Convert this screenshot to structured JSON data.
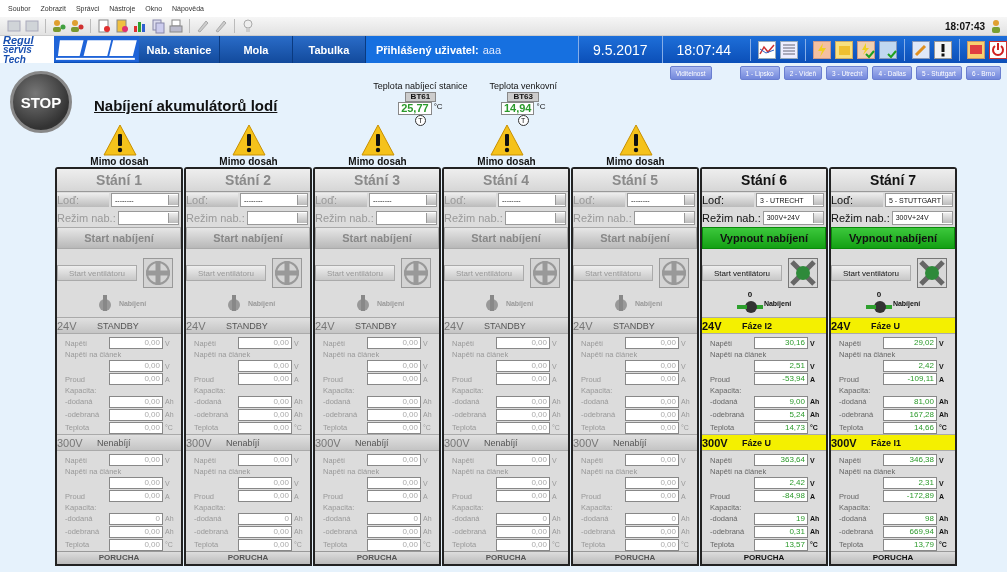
{
  "menu": [
    "Soubor",
    "Zobrazit",
    "Správci",
    "Nástroje",
    "Okno",
    "Nápověda"
  ],
  "toolbar": {
    "clock": "18:07:43"
  },
  "logo": {
    "line1": "Regul",
    "line2": "servis Tech"
  },
  "nav": {
    "tabs": [
      {
        "label": "Nab. stanice",
        "selected": false
      },
      {
        "label": "Mola",
        "selected": false
      },
      {
        "label": "Tabulka",
        "selected": false
      }
    ],
    "user_label": "Přihlášený uživatel:",
    "user_name": "aaa",
    "date": "9.5.2017",
    "time": "18:07:44"
  },
  "page": {
    "stop": "STOP",
    "title": "Nabíjení akumulátorů lodí",
    "sensors": [
      {
        "label": "Teplota nabíjecí stanice",
        "tag": "BT61",
        "value": "25,77",
        "unit": "°C",
        "mark": "T"
      },
      {
        "label": "Teplota venkovní",
        "tag": "BT63",
        "value": "14,94",
        "unit": "°C",
        "mark": "T"
      }
    ],
    "view_buttons": [
      "Viditelnost",
      "1 - Lipsko",
      "2 - Vídeň",
      "3 - Utrecht",
      "4 - Dallas",
      "5 - Stuttgart",
      "6 - Brno"
    ]
  },
  "stations": [
    {
      "title": "Stání 1",
      "warning": "Mimo dosah",
      "charging": false,
      "ship_label": "Loď:",
      "ship": "--------",
      "mode_label": "Režim nab.:",
      "charge_button": "Start nabíjení",
      "fan_button": "Start ventilátoru",
      "knob_label": "Nabíjení",
      "fault": "PORUCHA",
      "sections": [
        {
          "voltage": "24V",
          "status": "STANDBY",
          "highlighted": false,
          "rows": [
            {
              "kind": "inline",
              "label": "Napětí",
              "value": "0,00",
              "unit": "V"
            },
            {
              "kind": "caption",
              "label": "Napětí na článek"
            },
            {
              "kind": "field",
              "value": "0,00",
              "unit": "V"
            },
            {
              "kind": "inline",
              "label": "Proud",
              "value": "0,00",
              "unit": "A"
            },
            {
              "kind": "caption",
              "label": "Kapacita:"
            },
            {
              "kind": "inline",
              "label": "-dodaná",
              "value": "0,00",
              "unit": "Ah"
            },
            {
              "kind": "inline",
              "label": "-odebraná",
              "value": "0,00",
              "unit": "Ah"
            },
            {
              "kind": "inline",
              "label": "Teplota",
              "value": "0,00",
              "unit": "°C"
            }
          ]
        },
        {
          "voltage": "300V",
          "status": "Nenabíjí",
          "highlighted": false,
          "rows": [
            {
              "kind": "inline",
              "label": "Napětí",
              "value": "0,00",
              "unit": "V"
            },
            {
              "kind": "caption",
              "label": "Napětí na článek"
            },
            {
              "kind": "field",
              "value": "0,00",
              "unit": "V"
            },
            {
              "kind": "inline",
              "label": "Proud",
              "value": "0,00",
              "unit": "A"
            },
            {
              "kind": "caption",
              "label": "Kapacita:"
            },
            {
              "kind": "inline",
              "label": "-dodaná",
              "value": "0",
              "unit": "Ah"
            },
            {
              "kind": "inline",
              "label": "-odebraná",
              "value": "0,00",
              "unit": "Ah"
            },
            {
              "kind": "inline",
              "label": "Teplota",
              "value": "0,00",
              "unit": "°C"
            }
          ]
        }
      ]
    },
    {
      "title": "Stání 2",
      "warning": "Mimo dosah",
      "charging": false,
      "ship_label": "Loď:",
      "ship": "--------",
      "mode_label": "Režim nab.:",
      "charge_button": "Start nabíjení",
      "fan_button": "Start ventilátoru",
      "knob_label": "Nabíjení",
      "fault": "PORUCHA",
      "sections": [
        {
          "voltage": "24V",
          "status": "STANDBY",
          "highlighted": false,
          "rows": [
            {
              "kind": "inline",
              "label": "Napětí",
              "value": "0,00",
              "unit": "V"
            },
            {
              "kind": "caption",
              "label": "Napětí na článek"
            },
            {
              "kind": "field",
              "value": "0,00",
              "unit": "V"
            },
            {
              "kind": "inline",
              "label": "Proud",
              "value": "0,00",
              "unit": "A"
            },
            {
              "kind": "caption",
              "label": "Kapacita:"
            },
            {
              "kind": "inline",
              "label": "-dodaná",
              "value": "0,00",
              "unit": "Ah"
            },
            {
              "kind": "inline",
              "label": "-odebraná",
              "value": "0,00",
              "unit": "Ah"
            },
            {
              "kind": "inline",
              "label": "Teplota",
              "value": "0,00",
              "unit": "°C"
            }
          ]
        },
        {
          "voltage": "300V",
          "status": "Nenabíjí",
          "highlighted": false,
          "rows": [
            {
              "kind": "inline",
              "label": "Napětí",
              "value": "0,00",
              "unit": "V"
            },
            {
              "kind": "caption",
              "label": "Napětí na článek"
            },
            {
              "kind": "field",
              "value": "0,00",
              "unit": "V"
            },
            {
              "kind": "inline",
              "label": "Proud",
              "value": "0,00",
              "unit": "A"
            },
            {
              "kind": "caption",
              "label": "Kapacita:"
            },
            {
              "kind": "inline",
              "label": "-dodaná",
              "value": "0",
              "unit": "Ah"
            },
            {
              "kind": "inline",
              "label": "-odebraná",
              "value": "0,00",
              "unit": "Ah"
            },
            {
              "kind": "inline",
              "label": "Teplota",
              "value": "0,00",
              "unit": "°C"
            }
          ]
        }
      ]
    },
    {
      "title": "Stání 3",
      "warning": "Mimo dosah",
      "charging": false,
      "ship_label": "Loď:",
      "ship": "--------",
      "mode_label": "Režim nab.:",
      "charge_button": "Start nabíjení",
      "fan_button": "Start ventilátoru",
      "knob_label": "Nabíjení",
      "fault": "PORUCHA",
      "sections": [
        {
          "voltage": "24V",
          "status": "STANDBY",
          "highlighted": false,
          "rows": [
            {
              "kind": "inline",
              "label": "Napětí",
              "value": "0,00",
              "unit": "V"
            },
            {
              "kind": "caption",
              "label": "Napětí na článek"
            },
            {
              "kind": "field",
              "value": "0,00",
              "unit": "V"
            },
            {
              "kind": "inline",
              "label": "Proud",
              "value": "0,00",
              "unit": "A"
            },
            {
              "kind": "caption",
              "label": "Kapacita:"
            },
            {
              "kind": "inline",
              "label": "-dodaná",
              "value": "0,00",
              "unit": "Ah"
            },
            {
              "kind": "inline",
              "label": "-odebraná",
              "value": "0,00",
              "unit": "Ah"
            },
            {
              "kind": "inline",
              "label": "Teplota",
              "value": "0,00",
              "unit": "°C"
            }
          ]
        },
        {
          "voltage": "300V",
          "status": "Nenabíjí",
          "highlighted": false,
          "rows": [
            {
              "kind": "inline",
              "label": "Napětí",
              "value": "0,00",
              "unit": "V"
            },
            {
              "kind": "caption",
              "label": "Napětí na článek"
            },
            {
              "kind": "field",
              "value": "0,00",
              "unit": "V"
            },
            {
              "kind": "inline",
              "label": "Proud",
              "value": "0,00",
              "unit": "A"
            },
            {
              "kind": "caption",
              "label": "Kapacita:"
            },
            {
              "kind": "inline",
              "label": "-dodaná",
              "value": "0",
              "unit": "Ah"
            },
            {
              "kind": "inline",
              "label": "-odebraná",
              "value": "0,00",
              "unit": "Ah"
            },
            {
              "kind": "inline",
              "label": "Teplota",
              "value": "0,00",
              "unit": "°C"
            }
          ]
        }
      ]
    },
    {
      "title": "Stání 4",
      "warning": "Mimo dosah",
      "charging": false,
      "ship_label": "Loď:",
      "ship": "--------",
      "mode_label": "Režim nab.:",
      "charge_button": "Start nabíjení",
      "fan_button": "Start ventilátoru",
      "knob_label": "Nabíjení",
      "fault": "PORUCHA",
      "sections": [
        {
          "voltage": "24V",
          "status": "STANDBY",
          "highlighted": false,
          "rows": [
            {
              "kind": "inline",
              "label": "Napětí",
              "value": "0,00",
              "unit": "V"
            },
            {
              "kind": "caption",
              "label": "Napětí na článek"
            },
            {
              "kind": "field",
              "value": "0,00",
              "unit": "V"
            },
            {
              "kind": "inline",
              "label": "Proud",
              "value": "0,00",
              "unit": "A"
            },
            {
              "kind": "caption",
              "label": "Kapacita:"
            },
            {
              "kind": "inline",
              "label": "-dodaná",
              "value": "0,00",
              "unit": "Ah"
            },
            {
              "kind": "inline",
              "label": "-odebraná",
              "value": "0,00",
              "unit": "Ah"
            },
            {
              "kind": "inline",
              "label": "Teplota",
              "value": "0,00",
              "unit": "°C"
            }
          ]
        },
        {
          "voltage": "300V",
          "status": "Nenabíjí",
          "highlighted": false,
          "rows": [
            {
              "kind": "inline",
              "label": "Napětí",
              "value": "0,00",
              "unit": "V"
            },
            {
              "kind": "caption",
              "label": "Napětí na článek"
            },
            {
              "kind": "field",
              "value": "0,00",
              "unit": "V"
            },
            {
              "kind": "inline",
              "label": "Proud",
              "value": "0,00",
              "unit": "A"
            },
            {
              "kind": "caption",
              "label": "Kapacita:"
            },
            {
              "kind": "inline",
              "label": "-dodaná",
              "value": "0",
              "unit": "Ah"
            },
            {
              "kind": "inline",
              "label": "-odebraná",
              "value": "0,00",
              "unit": "Ah"
            },
            {
              "kind": "inline",
              "label": "Teplota",
              "value": "0,00",
              "unit": "°C"
            }
          ]
        }
      ]
    },
    {
      "title": "Stání 5",
      "warning": "Mimo dosah",
      "charging": false,
      "ship_label": "Loď:",
      "ship": "--------",
      "mode_label": "Režim nab.:",
      "charge_button": "Start nabíjení",
      "fan_button": "Start ventilátoru",
      "knob_label": "Nabíjení",
      "fault": "PORUCHA",
      "sections": [
        {
          "voltage": "24V",
          "status": "STANDBY",
          "highlighted": false,
          "rows": [
            {
              "kind": "inline",
              "label": "Napětí",
              "value": "0,00",
              "unit": "V"
            },
            {
              "kind": "caption",
              "label": "Napětí na článek"
            },
            {
              "kind": "field",
              "value": "0,00",
              "unit": "V"
            },
            {
              "kind": "inline",
              "label": "Proud",
              "value": "0,00",
              "unit": "A"
            },
            {
              "kind": "caption",
              "label": "Kapacita:"
            },
            {
              "kind": "inline",
              "label": "-dodaná",
              "value": "0,00",
              "unit": "Ah"
            },
            {
              "kind": "inline",
              "label": "-odebraná",
              "value": "0,00",
              "unit": "Ah"
            },
            {
              "kind": "inline",
              "label": "Teplota",
              "value": "0,00",
              "unit": "°C"
            }
          ]
        },
        {
          "voltage": "300V",
          "status": "Nenabíjí",
          "highlighted": false,
          "rows": [
            {
              "kind": "inline",
              "label": "Napětí",
              "value": "0,00",
              "unit": "V"
            },
            {
              "kind": "caption",
              "label": "Napětí na článek"
            },
            {
              "kind": "field",
              "value": "0,00",
              "unit": "V"
            },
            {
              "kind": "inline",
              "label": "Proud",
              "value": "0,00",
              "unit": "A"
            },
            {
              "kind": "caption",
              "label": "Kapacita:"
            },
            {
              "kind": "inline",
              "label": "-dodaná",
              "value": "0",
              "unit": "Ah"
            },
            {
              "kind": "inline",
              "label": "-odebraná",
              "value": "0,00",
              "unit": "Ah"
            },
            {
              "kind": "inline",
              "label": "Teplota",
              "value": "0,00",
              "unit": "°C"
            }
          ]
        }
      ]
    },
    {
      "title": "Stání 6",
      "charging": true,
      "ship_label": "Loď:",
      "ship": "3 - UTRECHT",
      "mode_label": "Režim nab.:",
      "mode": "300V+24V",
      "charge_button": "Vypnout nabíjení",
      "fan_button": "Start ventilátoru",
      "knob_mark": "0",
      "knob_label": "Nabíjení",
      "fault": "PORUCHA",
      "sections": [
        {
          "voltage": "24V",
          "status": "Fáze I2",
          "highlighted": true,
          "rows": [
            {
              "kind": "inline",
              "label": "Napětí",
              "value": "30,16",
              "unit": "V"
            },
            {
              "kind": "caption",
              "label": "Napětí na článek"
            },
            {
              "kind": "field",
              "value": "2,51",
              "unit": "V"
            },
            {
              "kind": "inline",
              "label": "Proud",
              "value": "-53,94",
              "unit": "A"
            },
            {
              "kind": "caption",
              "label": "Kapacita:"
            },
            {
              "kind": "inline",
              "label": "-dodaná",
              "value": "9,00",
              "unit": "Ah"
            },
            {
              "kind": "inline",
              "label": "-odebraná",
              "value": "5,24",
              "unit": "Ah"
            },
            {
              "kind": "inline",
              "label": "Teplota",
              "value": "14,73",
              "unit": "°C"
            }
          ]
        },
        {
          "voltage": "300V",
          "status": "Fáze U",
          "highlighted": true,
          "rows": [
            {
              "kind": "inline",
              "label": "Napětí",
              "value": "363,64",
              "unit": "V"
            },
            {
              "kind": "caption",
              "label": "Napětí na článek"
            },
            {
              "kind": "field",
              "value": "2,42",
              "unit": "V"
            },
            {
              "kind": "inline",
              "label": "Proud",
              "value": "-84,98",
              "unit": "A"
            },
            {
              "kind": "caption",
              "label": "Kapacita:"
            },
            {
              "kind": "inline",
              "label": "-dodaná",
              "value": "19",
              "unit": "Ah"
            },
            {
              "kind": "inline",
              "label": "-odebraná",
              "value": "0,31",
              "unit": "Ah"
            },
            {
              "kind": "inline",
              "label": "Teplota",
              "value": "13,57",
              "unit": "°C"
            }
          ]
        }
      ]
    },
    {
      "title": "Stání 7",
      "charging": true,
      "ship_label": "Loď:",
      "ship": "5 - STUTTGART",
      "mode_label": "Režim nab.:",
      "mode": "300V+24V",
      "charge_button": "Vypnout nabíjení",
      "fan_button": "Start ventilátoru",
      "knob_mark": "0",
      "knob_label": "Nabíjení",
      "fault": "PORUCHA",
      "sections": [
        {
          "voltage": "24V",
          "status": "Fáze U",
          "highlighted": true,
          "rows": [
            {
              "kind": "inline",
              "label": "Napětí",
              "value": "29,02",
              "unit": "V"
            },
            {
              "kind": "caption",
              "label": "Napětí na článek"
            },
            {
              "kind": "field",
              "value": "2,42",
              "unit": "V"
            },
            {
              "kind": "inline",
              "label": "Proud",
              "value": "-109,11",
              "unit": "A"
            },
            {
              "kind": "caption",
              "label": "Kapacita:"
            },
            {
              "kind": "inline",
              "label": "-dodaná",
              "value": "81,00",
              "unit": "Ah"
            },
            {
              "kind": "inline",
              "label": "-odebraná",
              "value": "167,28",
              "unit": "Ah"
            },
            {
              "kind": "inline",
              "label": "Teplota",
              "value": "14,66",
              "unit": "°C"
            }
          ]
        },
        {
          "voltage": "300V",
          "status": "Fáze I1",
          "highlighted": true,
          "rows": [
            {
              "kind": "inline",
              "label": "Napětí",
              "value": "346,38",
              "unit": "V"
            },
            {
              "kind": "caption",
              "label": "Napětí na článek"
            },
            {
              "kind": "field",
              "value": "2,31",
              "unit": "V"
            },
            {
              "kind": "inline",
              "label": "Proud",
              "value": "-172,89",
              "unit": "A"
            },
            {
              "kind": "caption",
              "label": "Kapacita:"
            },
            {
              "kind": "inline",
              "label": "-dodaná",
              "value": "98",
              "unit": "Ah"
            },
            {
              "kind": "inline",
              "label": "-odebraná",
              "value": "669,94",
              "unit": "Ah"
            },
            {
              "kind": "inline",
              "label": "Teplota",
              "value": "13,79",
              "unit": "°C"
            }
          ]
        }
      ]
    }
  ]
}
